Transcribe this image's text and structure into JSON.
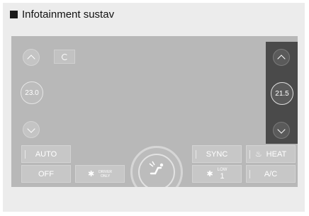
{
  "heading": {
    "title": "Infotainment sustav"
  },
  "climate": {
    "left_temp": "23.0",
    "right_temp": "21.5",
    "buttons": {
      "auto": "AUTO",
      "off": "OFF",
      "driver_only_line1": "DRIVER",
      "driver_only_line2": "ONLY",
      "sync": "SYNC",
      "heat": "HEAT",
      "fan_mode": "LOW",
      "fan_speed": "1",
      "ac": "A/C"
    }
  }
}
